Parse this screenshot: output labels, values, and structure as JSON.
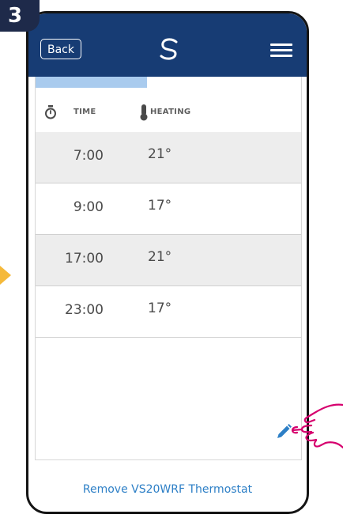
{
  "step": {
    "number": "3"
  },
  "header": {
    "back_label": "Back"
  },
  "schedule": {
    "time_header": "TIME",
    "heating_header": "HEATING",
    "progress_fraction": 0.42,
    "rows": [
      {
        "time": "7:00",
        "temp": "21°"
      },
      {
        "time": "9:00",
        "temp": "17°"
      },
      {
        "time": "17:00",
        "temp": "21°"
      },
      {
        "time": "23:00",
        "temp": "17°"
      }
    ]
  },
  "footer": {
    "remove_label": "Remove VS20WRF Thermostat"
  },
  "colors": {
    "topbar": "#173c74",
    "accent_link": "#2d7fc6",
    "progress": "#a9cbee",
    "hand_outline": "#d6006e",
    "step_badge": "#1e2a4a",
    "arrow": "#f5b93a"
  },
  "icons": [
    "clock-icon",
    "thermometer-icon",
    "pencil-icon",
    "menu-icon",
    "logo-icon",
    "pointing-hand-icon"
  ]
}
